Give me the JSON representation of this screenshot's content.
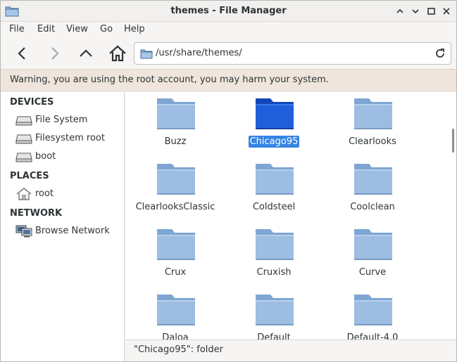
{
  "window": {
    "title": "themes - File Manager",
    "controls": {
      "minimize": "⌃",
      "maximize": "⌄",
      "restore": "□",
      "close": "✕"
    }
  },
  "menubar": {
    "items": [
      "File",
      "Edit",
      "View",
      "Go",
      "Help"
    ]
  },
  "toolbar": {
    "back_icon": "chevron-left-icon",
    "forward_icon": "chevron-right-icon",
    "up_icon": "chevron-up-icon",
    "home_icon": "home-icon",
    "location": "/usr/share/themes/",
    "reload_icon": "reload-icon"
  },
  "infobar": {
    "message": "Warning, you are using the root account, you may harm your system."
  },
  "sidebar": {
    "sections": [
      {
        "heading": "DEVICES",
        "items": [
          {
            "label": "File System",
            "icon": "drive-icon"
          },
          {
            "label": "Filesystem root",
            "icon": "drive-icon"
          },
          {
            "label": "boot",
            "icon": "drive-icon"
          }
        ]
      },
      {
        "heading": "PLACES",
        "items": [
          {
            "label": "root",
            "icon": "home-icon"
          }
        ]
      },
      {
        "heading": "NETWORK",
        "items": [
          {
            "label": "Browse Network",
            "icon": "network-icon"
          }
        ]
      }
    ]
  },
  "files": [
    {
      "name": "Buzz",
      "selected": false
    },
    {
      "name": "Chicago95",
      "selected": true
    },
    {
      "name": "Clearlooks",
      "selected": false
    },
    {
      "name": "ClearlooksClassic",
      "selected": false
    },
    {
      "name": "Coldsteel",
      "selected": false
    },
    {
      "name": "Coolclean",
      "selected": false
    },
    {
      "name": "Crux",
      "selected": false
    },
    {
      "name": "Cruxish",
      "selected": false
    },
    {
      "name": "Curve",
      "selected": false
    },
    {
      "name": "Daloa",
      "selected": false
    },
    {
      "name": "Default",
      "selected": false
    },
    {
      "name": "Default-4.0",
      "selected": false
    }
  ],
  "statusbar": {
    "text": "\"Chicago95\": folder"
  },
  "colors": {
    "folder": "#8fb3db",
    "folder_selected": "#1e5fd6",
    "selection": "#3584e4",
    "infobar": "#efe5dc"
  }
}
